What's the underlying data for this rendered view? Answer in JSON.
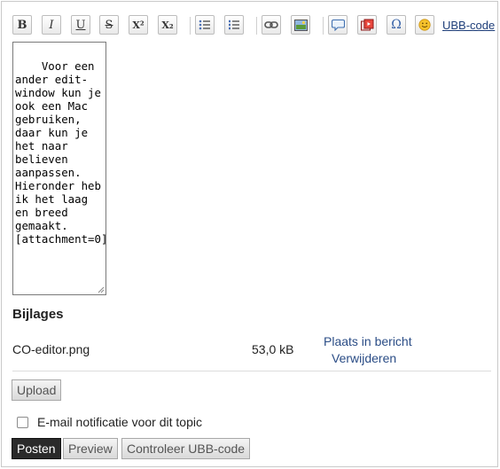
{
  "toolbar": {
    "buttons": [
      {
        "name": "bold-button",
        "icon": "bold-icon",
        "glyph": "B"
      },
      {
        "name": "italic-button",
        "icon": "italic-icon",
        "glyph": "I"
      },
      {
        "name": "underline-button",
        "icon": "underline-icon",
        "glyph": "U"
      },
      {
        "name": "strikethrough-button",
        "icon": "strikethrough-icon",
        "glyph": "S"
      },
      {
        "name": "superscript-button",
        "icon": "superscript-icon",
        "glyph": "X²"
      },
      {
        "name": "subscript-button",
        "icon": "subscript-icon",
        "glyph": "X₂"
      },
      {
        "name": "bullet-list-button",
        "icon": "bullet-list-icon"
      },
      {
        "name": "numbered-list-button",
        "icon": "numbered-list-icon"
      },
      {
        "name": "link-button",
        "icon": "link-icon"
      },
      {
        "name": "image-button",
        "icon": "image-icon"
      },
      {
        "name": "quote-button",
        "icon": "speech-bubble-icon"
      },
      {
        "name": "youtube-button",
        "icon": "video-icon"
      },
      {
        "name": "special-char-button",
        "icon": "omega-icon",
        "glyph": "Ω"
      },
      {
        "name": "smiley-button",
        "icon": "smiley-icon"
      }
    ],
    "ubb_link": "UBB-code"
  },
  "editor": {
    "text": "Voor een ander edit-window kun je ook een Mac gebruiken, daar kun je het naar believen aanpassen. Hieronder heb ik het laag en breed gemaakt.\n[attachment=0]"
  },
  "attachments": {
    "title": "Bijlages",
    "items": [
      {
        "filename": "CO-editor.png",
        "size": "53,0 kB",
        "insert_label": "Plaats in bericht",
        "delete_label": "Verwijderen"
      }
    ]
  },
  "upload_label": "Upload",
  "notify_label": "E-mail notificatie voor dit topic",
  "notify_checked": false,
  "actions": {
    "post_label": "Posten",
    "preview_label": "Preview",
    "check_label": "Controleer UBB-code"
  },
  "colors": {
    "link": "#2b4d86",
    "primary_button": "#2a2a2a",
    "smiley": "#f6c22c"
  }
}
